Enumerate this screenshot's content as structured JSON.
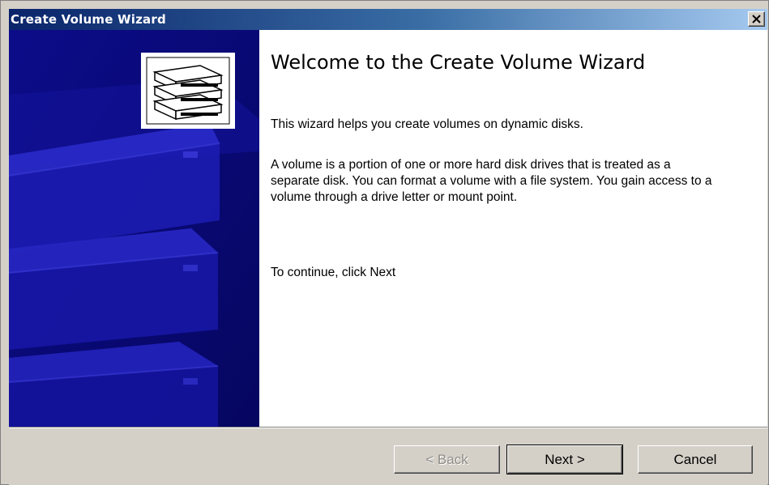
{
  "window": {
    "title": "Create Volume Wizard",
    "close_symbol": "×",
    "title_gradient": [
      "#0a246a",
      "#a6caf0"
    ],
    "banner_color": "#0a0a78"
  },
  "banner": {
    "icon": "server-stack-icon"
  },
  "content": {
    "heading": "Welcome to the Create Volume Wizard",
    "intro": "This wizard helps you create volumes on dynamic disks.",
    "description": "A volume is a portion of one or more hard disk drives that is treated as a separate disk. You can format a volume with a file system. You gain access to a volume through a drive letter or mount point.",
    "continue_hint": "To continue, click Next"
  },
  "buttons": {
    "back": "< Back",
    "next": "Next >",
    "cancel": "Cancel"
  }
}
